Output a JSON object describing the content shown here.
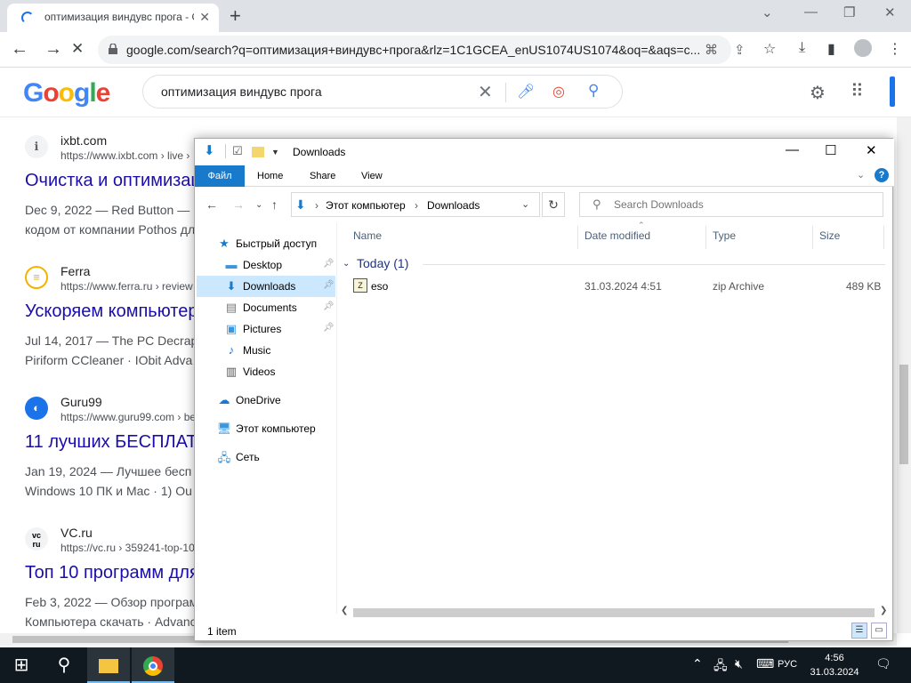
{
  "browser": {
    "tab_title": "оптимизация виндувс прога - G",
    "url": "google.com/search?q=оптимизация+виндувс+прога&rlz=1C1GCEA_enUS1074US1074&oq=&aqs=c...",
    "icons": [
      "reload-stop-icon",
      "lock-icon",
      "translate-icon",
      "share-icon",
      "star-icon",
      "download-icon",
      "sidepanel-icon",
      "profile-icon",
      "menu-icon"
    ]
  },
  "google": {
    "logo": "Google",
    "query": "оптимизация виндувс прога",
    "results": [
      {
        "site": "ixbt.com",
        "cite": "https://www.ixbt.com › live ›",
        "title": "Очистка и оптимизация",
        "snippet1": "Dec 9, 2022 — Red Button —",
        "snippet2": "кодом от компании Pothos дл"
      },
      {
        "site": "Ferra",
        "cite": "https://www.ferra.ru › review",
        "title": "Ускоряем компьютер",
        "snippet1": "Jul 14, 2017 — The PC Decrap",
        "snippet2": "Piriform CCleaner · IObit Adva"
      },
      {
        "site": "Guru99",
        "cite": "https://www.guru99.com › be",
        "title": "11 лучших БЕСПЛАТ",
        "snippet1": "Jan 19, 2024 — Лучшее бесп",
        "snippet2": "Windows 10 ПК и Mac · 1) Ou"
      },
      {
        "site": "VC.ru",
        "cite": "https://vc.ru › 359241-top-10",
        "title": "Топ 10 программ для",
        "snippet1": "Feb 3, 2022 — Обзор програм",
        "snippet2": "Компьютера скачать · Advanc"
      }
    ]
  },
  "explorer": {
    "title": "Downloads",
    "ribbon": {
      "file": "Файл",
      "home": "Home",
      "share": "Share",
      "view": "View",
      "help": "?"
    },
    "breadcrumb": [
      "Этот компьютер",
      "Downloads"
    ],
    "search_placeholder": "Search Downloads",
    "nav": {
      "quick_access": "Быстрый доступ",
      "desktop": "Desktop",
      "downloads": "Downloads",
      "documents": "Documents",
      "pictures": "Pictures",
      "music": "Music",
      "videos": "Videos",
      "onedrive": "OneDrive",
      "this_pc": "Этот компьютер",
      "network": "Сеть"
    },
    "columns": {
      "name": "Name",
      "date": "Date modified",
      "type": "Type",
      "size": "Size"
    },
    "group": "Today (1)",
    "files": [
      {
        "name": "eso",
        "date": "31.03.2024 4:51",
        "type": "zip Archive",
        "size": "489 KB"
      }
    ],
    "status": "1 item"
  },
  "taskbar": {
    "lang": "РУС",
    "time": "4:56",
    "date": "31.03.2024"
  },
  "colors": {
    "accent": "#1979ca",
    "google_blue": "#4285f4",
    "link": "#1a0dab",
    "taskbar": "#101820"
  }
}
